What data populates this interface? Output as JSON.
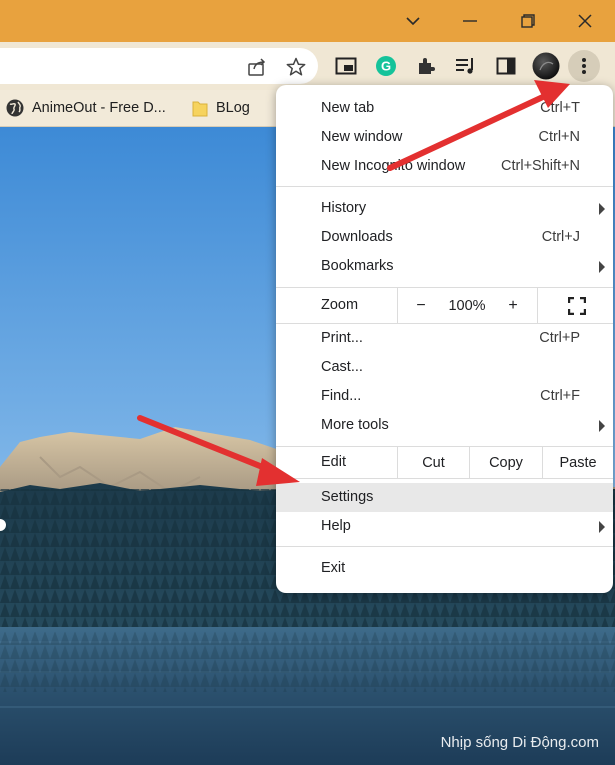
{
  "colors": {
    "titlebar": "#e8a23e",
    "toolbar": "#f0e7d4",
    "arrow": "#e33030",
    "highlight": "#e8e8e8"
  },
  "window_controls": [
    {
      "name": "chevron-down-icon",
      "glyph": "⌄"
    },
    {
      "name": "minimize-icon",
      "glyph": "—"
    },
    {
      "name": "restore-icon",
      "glyph": "❐"
    },
    {
      "name": "close-icon",
      "glyph": "✕"
    }
  ],
  "toolbar_icons": [
    "share-icon",
    "star-icon",
    "picture-in-picture-icon",
    "grammarly-icon",
    "extensions-icon",
    "reading-list-icon",
    "side-panel-icon",
    "profile-avatar",
    "more-menu-icon"
  ],
  "bookmarks": {
    "item1": {
      "label": "AnimeOut - Free D...",
      "icon": "globe-icon"
    },
    "item2": {
      "label": "BLog",
      "icon": "folder-icon"
    }
  },
  "menu": {
    "new_tab": {
      "label": "New tab",
      "shortcut": "Ctrl+T"
    },
    "new_window": {
      "label": "New window",
      "shortcut": "Ctrl+N"
    },
    "incognito": {
      "label": "New Incognito window",
      "shortcut": "Ctrl+Shift+N"
    },
    "history": {
      "label": "History"
    },
    "downloads": {
      "label": "Downloads",
      "shortcut": "Ctrl+J"
    },
    "bookmarks": {
      "label": "Bookmarks"
    },
    "zoom": {
      "label": "Zoom",
      "minus": "−",
      "value": "100%",
      "plus": "+"
    },
    "print": {
      "label": "Print...",
      "shortcut": "Ctrl+P"
    },
    "cast": {
      "label": "Cast..."
    },
    "find": {
      "label": "Find...",
      "shortcut": "Ctrl+F"
    },
    "more_tools": {
      "label": "More tools"
    },
    "edit": {
      "label": "Edit",
      "cut": "Cut",
      "copy": "Copy",
      "paste": "Paste"
    },
    "settings": {
      "label": "Settings"
    },
    "help": {
      "label": "Help"
    },
    "exit": {
      "label": "Exit"
    }
  },
  "watermark": "Nhịp sống Di Động.com"
}
